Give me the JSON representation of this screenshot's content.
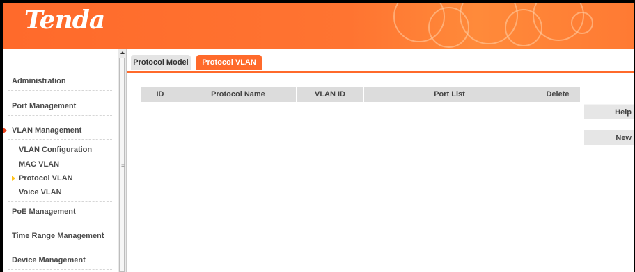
{
  "header": {
    "logo_text": "Tenda",
    "brand_color": "#ff6a2b"
  },
  "sidebar": {
    "items": [
      {
        "label": "Administration"
      },
      {
        "label": "Port Management"
      },
      {
        "label": "VLAN Management",
        "expanded": true
      },
      {
        "label": "PoE Management"
      },
      {
        "label": "Time Range Management"
      },
      {
        "label": "Device Management"
      }
    ],
    "vlan_subitems": [
      {
        "label": "VLAN Configuration"
      },
      {
        "label": "MAC VLAN"
      },
      {
        "label": "Protocol VLAN",
        "selected": true
      },
      {
        "label": "Voice VLAN"
      }
    ]
  },
  "tabs": [
    {
      "label": "Protocol Model",
      "active": false
    },
    {
      "label": "Protocol VLAN",
      "active": true
    }
  ],
  "table": {
    "columns": [
      "ID",
      "Protocol Name",
      "VLAN ID",
      "Port List",
      "Delete"
    ],
    "rows": []
  },
  "buttons": {
    "help": "Help",
    "new": "New"
  },
  "icons": {
    "scroll_up": "scroll-up-arrow-icon",
    "grip": "scrollbar-grip-icon"
  }
}
